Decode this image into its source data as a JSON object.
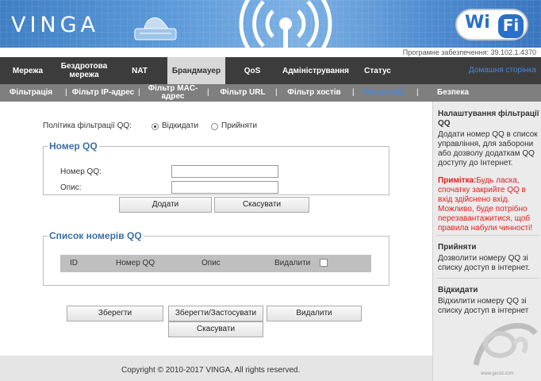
{
  "brand": {
    "logo": "VINGA",
    "wifi_badge_left": "Wi",
    "wifi_badge_right": "Fi"
  },
  "firmware": "Програмне забезпечення: 39.102.1.4370",
  "nav": {
    "items": [
      "Мережа",
      "Бездротова мережа",
      "NAT",
      "Брандмауер",
      "QoS",
      "Адміністрування",
      "Статус"
    ],
    "active": "Брандмауер",
    "home_link": "Домашня сторінка"
  },
  "subnav": {
    "items": [
      "Фільтрація",
      "Фільтр IP-адрес",
      "Фільтр MAC-адрес",
      "Фільтр URL",
      "Фільтр хостів",
      "Фільтр QQ",
      "Безпека"
    ],
    "active": "Фільтр QQ"
  },
  "policy": {
    "label": "Політика фільтрації QQ:",
    "deny_label": "Відкидати",
    "accept_label": "Прийняти",
    "selected": "deny"
  },
  "qq_number_section": {
    "legend": "Номер QQ",
    "number_label": "Номер QQ:",
    "number_value": "",
    "description_label": "Опис:",
    "description_value": "",
    "add_button": "Додати",
    "cancel_button": "Скасувати"
  },
  "qq_list_section": {
    "legend": "Список номерів QQ",
    "columns": [
      "ID",
      "Номер QQ",
      "Опис",
      "Видалити"
    ],
    "rows": []
  },
  "actions": {
    "save": "Зберегти",
    "save_apply": "Зберегти/Застосувати",
    "delete": "Видалити",
    "cancel": "Скасувати"
  },
  "footer": {
    "copyright": "Copyright © 2010-2017 VINGA, All rights reserved."
  },
  "sidebar": {
    "settings_title": "Налаштування фільтрації QQ",
    "settings_text": "Додати номер QQ в список управління, для заборони або дозволу додаткам QQ доступу до Інтернет.",
    "note_label": "Примітка:",
    "note_text": "Будь ласка, спочатку закрийте QQ в вхід здійснено вхід. Можливо, буде потрібно перезавантажитися, щоб правила набули чинності!",
    "accept_title": "Прийняти",
    "accept_text": "Дозволити номеру QQ зі списку доступ в інтернет.",
    "deny_title": "Відкидати",
    "deny_text": "Відхилити номеру QQ зі списку доступ в інтернет",
    "watermark": "www.gecid.com"
  },
  "colors": {
    "nav_bg": "#3c3c3c",
    "subnav_bg": "#7f7f7f",
    "accent": "#4b86d8",
    "legend": "#3c6ea6",
    "warning": "#e02020"
  }
}
